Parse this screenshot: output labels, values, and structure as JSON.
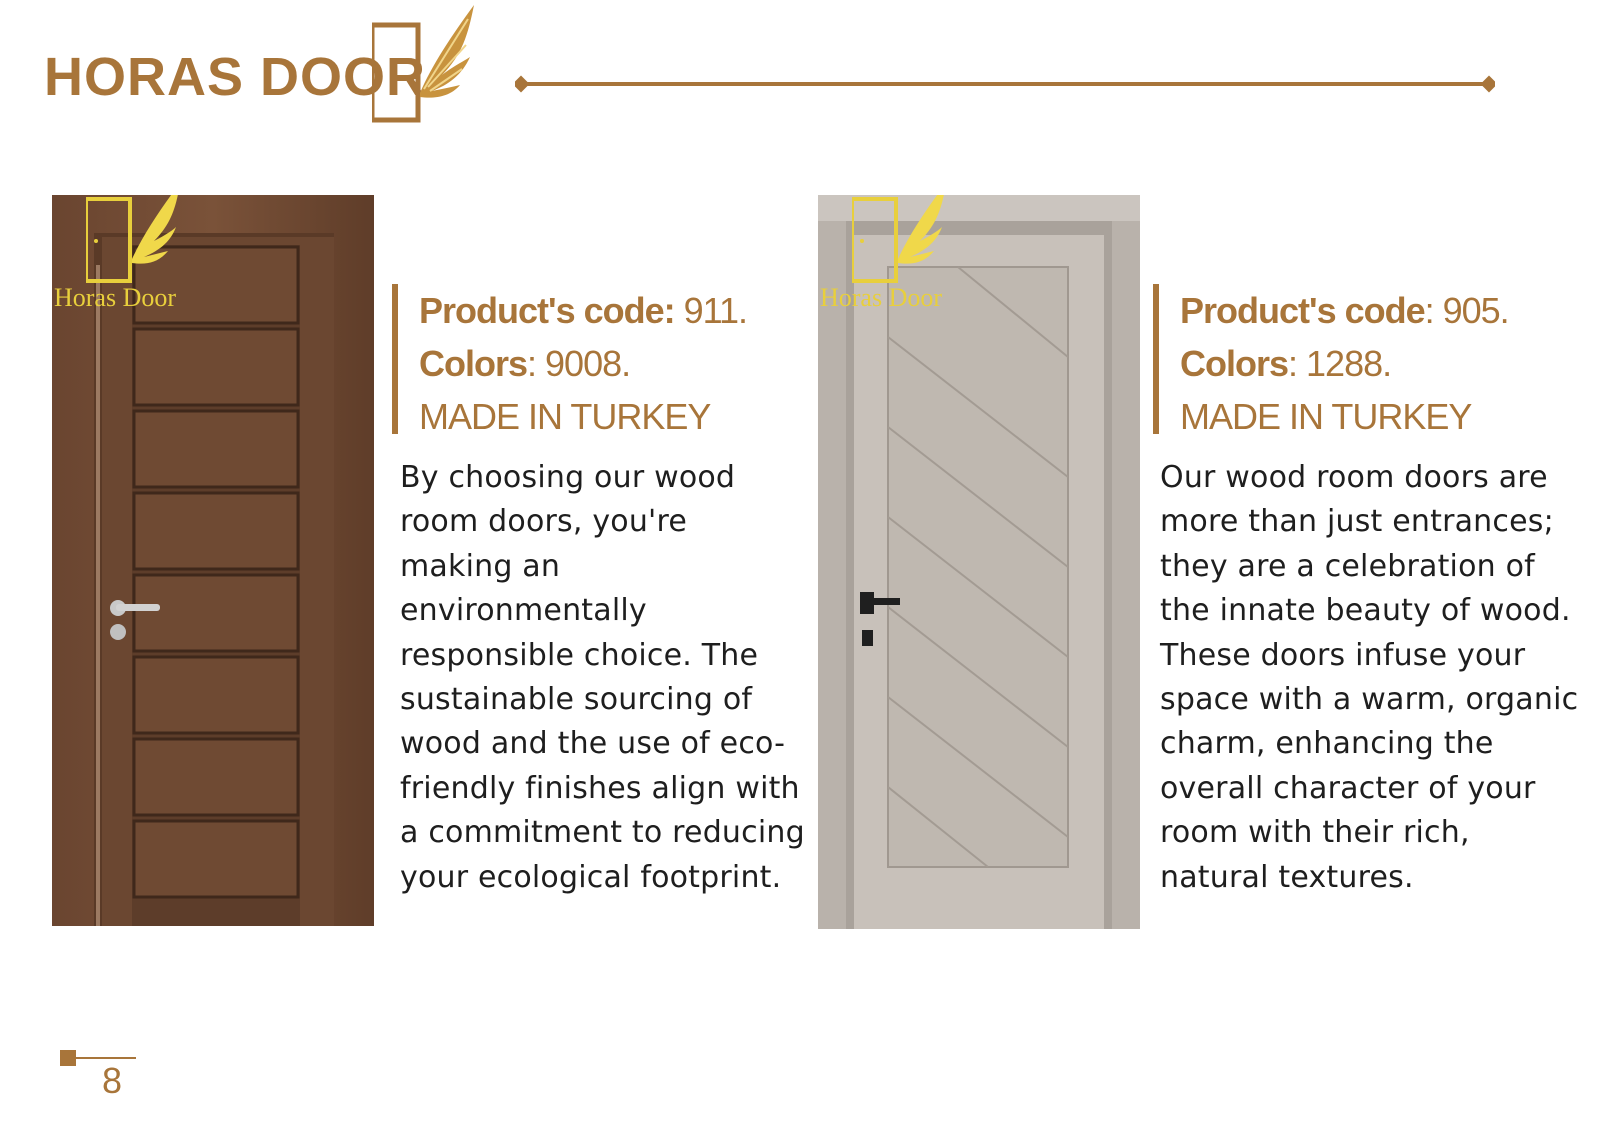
{
  "header": {
    "brand": "HORAS DOOR",
    "accent_color": "#a8753a",
    "logo_icon": "winged-door-icon",
    "divider_icon": "diamond-line-divider"
  },
  "products": [
    {
      "photo_icon": "brown-wood-door-image",
      "photo_watermark": "Horas Door",
      "code_label": "Product's code:",
      "code_value": " 911.",
      "colors_label": "Colors",
      "colors_value": ":  9008.",
      "origin": "MADE IN TURKEY",
      "description": "By choosing our wood room doors, you're making an environmentally responsible choice. The sustainable sourcing of wood and the use of eco-friendly finishes align with a commitment to reducing your ecological footprint."
    },
    {
      "photo_icon": "grey-wood-door-image",
      "photo_watermark": "Horas Door",
      "code_label": "Product's  code",
      "code_value": ": 905.",
      "colors_label": "Colors",
      "colors_value": ": 1288.",
      "origin": "MADE IN TURKEY",
      "description": "Our wood room doors are more than just entrances; they are a celebration of the innate beauty of wood. These doors infuse your space with a warm, organic charm, enhancing the overall character of your room with their rich, natural textures."
    }
  ],
  "footer": {
    "page_number": "8"
  }
}
